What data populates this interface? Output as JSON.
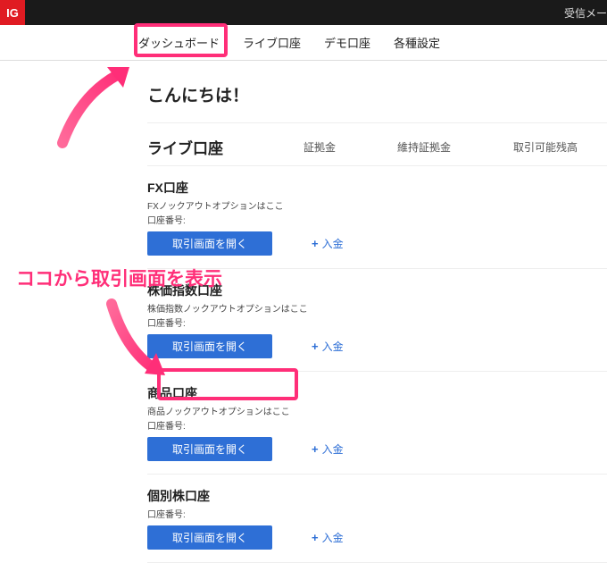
{
  "topbar": {
    "logo": "IG",
    "mail": "受信メー"
  },
  "nav": {
    "tabs": [
      {
        "label": "ダッシュボード",
        "active": true
      },
      {
        "label": "ライブ口座",
        "active": false
      },
      {
        "label": "デモ口座",
        "active": false
      },
      {
        "label": "各種設定",
        "active": false
      }
    ]
  },
  "greeting": "こんにちは！",
  "section": {
    "title": "ライブ口座",
    "col_margin": "証拠金",
    "col_maint": "維持証拠金",
    "col_avail": "取引可能残高"
  },
  "accounts": [
    {
      "name": "FX口座",
      "sub": "FXノックアウトオプションはここ",
      "sub2": "口座番号:",
      "open_label": "取引画面を開く",
      "deposit_label": "入金"
    },
    {
      "name": "株価指数口座",
      "sub": "株価指数ノックアウトオプションはここ",
      "sub2": "口座番号:",
      "open_label": "取引画面を開く",
      "deposit_label": "入金"
    },
    {
      "name": "商品口座",
      "sub": "商品ノックアウトオプションはここ",
      "sub2": "口座番号:",
      "open_label": "取引画面を開く",
      "deposit_label": "入金"
    },
    {
      "name": "個別株口座",
      "sub": "",
      "sub2": "口座番号:",
      "open_label": "取引画面を開く",
      "deposit_label": "入金"
    }
  ],
  "annotation": {
    "text": "ココから取引画面を表示"
  }
}
